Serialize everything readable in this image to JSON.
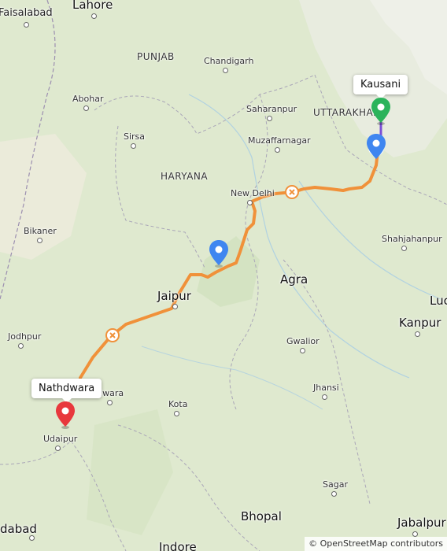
{
  "map": {
    "attribution": "© OpenStreetMap contributors",
    "colors": {
      "route": "#f0913a",
      "route_short": "#7b4fd6",
      "start_pin": "#e8383d",
      "end_pin": "#2bb35b",
      "stop_pin": "#3f86f0",
      "event_icon": "#7b4fd6"
    },
    "callouts": {
      "start": "Nathdwara",
      "end": "Kausani"
    },
    "states": {
      "punjab": "PUNJAB",
      "haryana": "HARYANA",
      "uttarakhand": "UTTARAKHAND"
    },
    "cities": {
      "faisalabad": "Faisalabad",
      "lahore": "Lahore",
      "chandigarh": "Chandigarh",
      "abohar": "Abohar",
      "sirsa": "Sirsa",
      "saharanpur": "Saharanpur",
      "muzaffarnagar": "Muzaffarnagar",
      "new_delhi": "New Delhi",
      "bikaner": "Bikaner",
      "shahjahanpur": "Shahjahanpur",
      "agra": "Agra",
      "jaipur": "Jaipur",
      "lucknow": "Luc",
      "kanpur": "Kanpur",
      "jodhpur": "Jodhpur",
      "gwalior": "Gwalior",
      "bhilwara": "hilwara",
      "jhansi": "Jhansi",
      "kota": "Kota",
      "udaipur": "Udaipur",
      "sagar": "Sagar",
      "ahmedabad": "dabad",
      "bhopal": "Bhopal",
      "jabalpur": "Jabalpur",
      "indore": "Indore"
    }
  }
}
